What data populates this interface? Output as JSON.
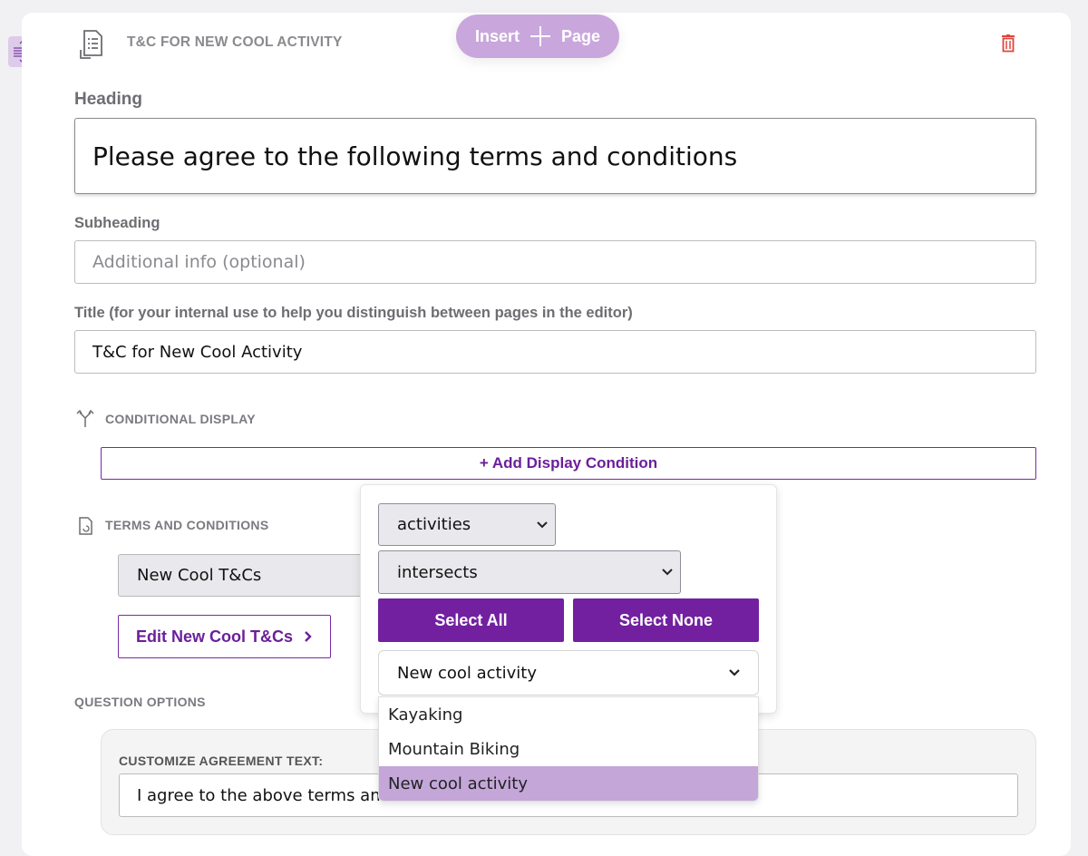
{
  "header": {
    "page_title": "T&C FOR NEW COOL ACTIVITY",
    "insert_label": "Insert",
    "page_label": "Page"
  },
  "heading": {
    "label": "Heading",
    "value": "Please agree to the following terms and conditions"
  },
  "subheading": {
    "label": "Subheading",
    "placeholder": "Additional info (optional)"
  },
  "title_field": {
    "label": "Title (for your internal use to help you distinguish between pages in the editor)",
    "value": "T&C for New Cool Activity"
  },
  "conditional_display": {
    "label": "CONDITIONAL DISPLAY",
    "add_button": "+ Add Display Condition"
  },
  "terms": {
    "label": "TERMS AND CONDITIONS",
    "selected": "New Cool T&Cs",
    "edit_button": "Edit New Cool T&Cs"
  },
  "condition_popover": {
    "field_select": "activities",
    "operator_select": "intersects",
    "select_all": "Select All",
    "select_none": "Select None",
    "value_select": "New cool activity",
    "options": [
      {
        "label": "Kayaking",
        "selected": false
      },
      {
        "label": "Mountain Biking",
        "selected": false
      },
      {
        "label": "New cool activity",
        "selected": true
      }
    ]
  },
  "question_options": {
    "label": "QUESTION OPTIONS",
    "agreement_label": "CUSTOMIZE AGREEMENT TEXT:",
    "agreement_value": "I agree to the above terms and c"
  },
  "colors": {
    "accent": "#7220a0",
    "accent_light": "#c9a7dc",
    "delete": "#e0453a"
  }
}
